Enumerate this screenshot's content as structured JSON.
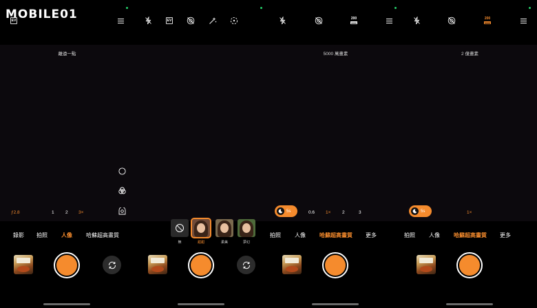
{
  "watermark": {
    "text": "MOBILE01"
  },
  "colors": {
    "accent": "#f58b2d",
    "indicator": "#25d06a",
    "background": "#000000",
    "viewfinder": "#0c090d"
  },
  "panels": [
    {
      "top_icons": [
        "ev-icon",
        "menu-icon"
      ],
      "ev_label": "EV",
      "viewfinder_label": "離遠一點",
      "aperture_label": "ƒ2.8",
      "zoom_levels": [
        "1",
        "2",
        "3×"
      ],
      "active_zoom": "3×",
      "side_icons": [
        "shutter-circle-icon",
        "filter-layers-icon",
        "portrait-settings-icon"
      ],
      "modes": [
        "錄影",
        "拍照",
        "人像",
        "哈蘇超高畫質"
      ],
      "active_mode": "人像"
    },
    {
      "top_icons": [
        "flash-off-icon",
        "ev-icon",
        "live-photo-off-icon",
        "beauty-icon",
        "focus-icon"
      ],
      "ev_label": "EV",
      "filters": [
        {
          "label": "無",
          "icon": "none-icon"
        },
        {
          "label": "甜甜",
          "selected": true
        },
        {
          "label": "柔美"
        },
        {
          "label": "夢幻"
        }
      ]
    },
    {
      "top_icons": [
        "flash-off-icon",
        "live-photo-off-icon",
        "megapixel-icon",
        "menu-icon"
      ],
      "megapixel_label": "200",
      "viewfinder_label": "5000 萬畫素",
      "night_label": "5s",
      "zoom_levels": [
        "0.6",
        "1×",
        "2",
        "3"
      ],
      "active_zoom": "1×",
      "modes": [
        "拍照",
        "人像",
        "哈蘇超高畫質",
        "更多"
      ],
      "active_mode": "哈蘇超高畫質"
    },
    {
      "top_icons": [
        "flash-off-icon",
        "live-photo-off-icon",
        "megapixel-icon",
        "menu-icon"
      ],
      "megapixel_label": "200",
      "viewfinder_label": "2 億畫素",
      "night_label": "5s",
      "zoom_levels": [
        "1×"
      ],
      "active_zoom": "1×",
      "modes": [
        "拍照",
        "人像",
        "哈蘇超高畫質",
        "更多"
      ],
      "active_mode": "哈蘇超高畫質"
    }
  ]
}
